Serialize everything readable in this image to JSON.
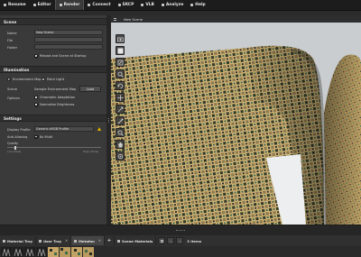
{
  "topnav": {
    "items": [
      {
        "label": "Resume",
        "active": false
      },
      {
        "label": "Editor",
        "active": false
      },
      {
        "label": "Render",
        "active": true
      },
      {
        "label": "Connect",
        "active": false
      },
      {
        "label": "SKCP",
        "active": false
      },
      {
        "label": "VLB",
        "active": false
      },
      {
        "label": "Analyze",
        "active": false
      },
      {
        "label": "Help",
        "active": false
      }
    ]
  },
  "scene_panel": {
    "header": "Scene",
    "name_label": "Name",
    "name_value": "New Scene",
    "file_label": "File",
    "file_value": "",
    "folder_label": "Folder",
    "folder_value": "",
    "reload_label": "Reload and Scene at Startup",
    "reload_checked": true
  },
  "illumination_panel": {
    "header": "Illumination",
    "mode_env_label": "Environment Map",
    "mode_env_selected": true,
    "mode_point_label": "Point Light",
    "mode_point_selected": false,
    "scene_label": "Scene",
    "scene_value": "Sample Environment Map",
    "load_button": "Load",
    "options_label": "Options",
    "chromatic_label": "Chromatic Adaptation",
    "chromatic_checked": false,
    "normalize_label": "Normalize Brightness",
    "normalize_checked": true
  },
  "settings_panel": {
    "header": "Settings",
    "display_profile_label": "Display Profile",
    "display_profile_value": "Generic sRGB Profile",
    "anti_aliasing_label": "Anti-Aliasing",
    "anti_aliasing_value": "8x Multi",
    "quality_label": "Quality",
    "quality_left": "Low (Fast)",
    "quality_right": "High (Slow)",
    "quality_fraction": 0.08
  },
  "viewport": {
    "title": "New Scene"
  },
  "bottom": {
    "tabs": [
      {
        "label": "Material Tray",
        "active": false
      },
      {
        "label": "User Tray",
        "active": false
      },
      {
        "label": "Metafan",
        "active": true
      },
      {
        "label": "Scene Materials",
        "active": false
      }
    ],
    "count_text": "3 Items"
  },
  "colors": {
    "accent_warning": "#e5b300",
    "fabric_tan": "#c8a86a",
    "fabric_green": "#3f6b48",
    "fabric_dark": "#2a2a22",
    "background_wall": "#c9cdd0"
  },
  "icons": [
    "menu-icon",
    "camera-icon",
    "box-icon",
    "frame-icon",
    "zoom-icon",
    "rotate-icon",
    "move-icon",
    "pan-icon",
    "home-icon",
    "reset-icon",
    "warning-icon",
    "plus-icon",
    "close-icon",
    "arrow-left-icon",
    "arrow-right-icon"
  ]
}
